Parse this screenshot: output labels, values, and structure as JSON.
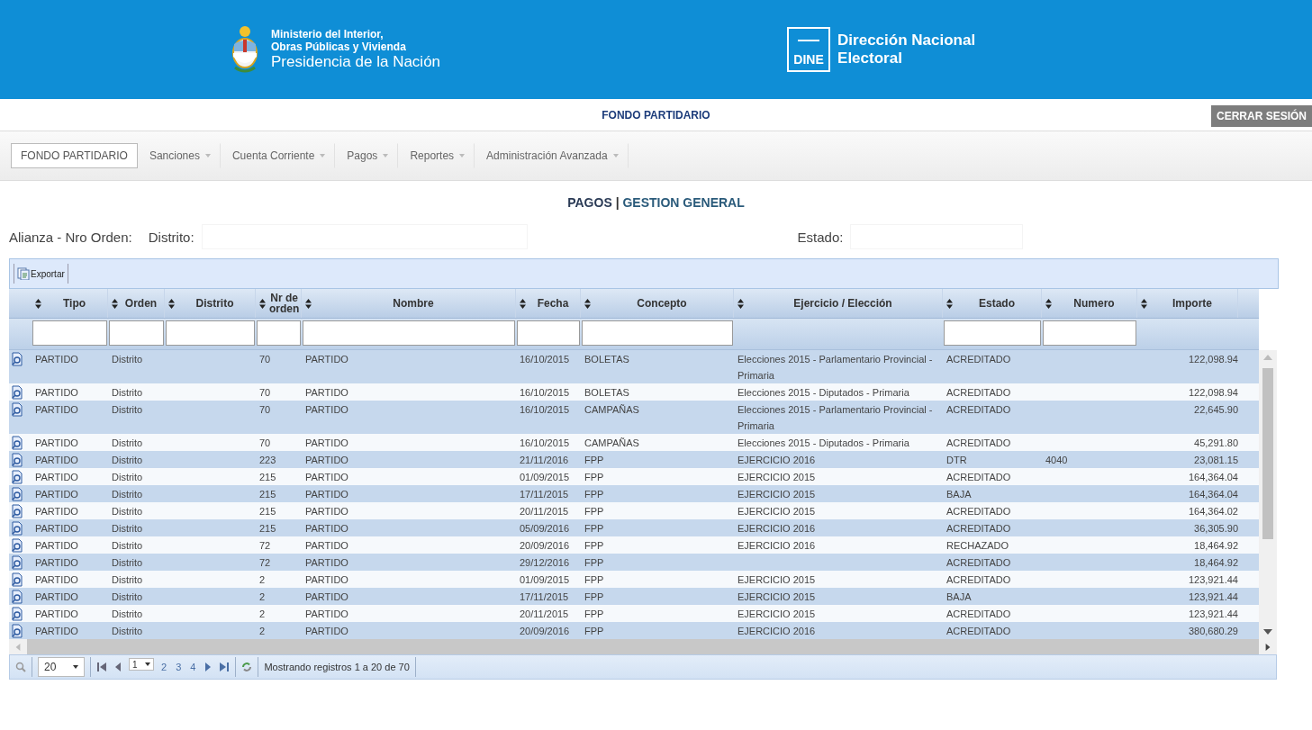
{
  "header": {
    "ministry_lines": [
      "Ministerio del Interior,",
      "Obras Públicas y Vivienda"
    ],
    "presidency": "Presidencia de la Nación",
    "dine_badge": "DINE",
    "dine_title_lines": [
      "Dirección Nacional",
      "Electoral"
    ]
  },
  "top_bar": {
    "title": "FONDO PARTIDARIO",
    "logout": "CERRAR SESIÓN"
  },
  "menu": [
    {
      "label": "FONDO PARTIDARIO",
      "selected": true,
      "dropdown": false
    },
    {
      "label": "Sanciones",
      "selected": false,
      "dropdown": true
    },
    {
      "label": "Cuenta Corriente",
      "selected": false,
      "dropdown": true
    },
    {
      "label": "Pagos",
      "selected": false,
      "dropdown": true
    },
    {
      "label": "Reportes",
      "selected": false,
      "dropdown": true
    },
    {
      "label": "Administración Avanzada",
      "selected": false,
      "dropdown": true
    }
  ],
  "page_title": {
    "section": "PAGOS",
    "separator": "|",
    "subtitle": "GESTION GENERAL"
  },
  "filters": [
    {
      "label": "Alianza - Nro Orden:",
      "kind": "label"
    },
    {
      "label": "Distrito:",
      "kind": "input"
    },
    {
      "label": "Estado:",
      "kind": "input"
    }
  ],
  "toolbar": {
    "export": "Exportar"
  },
  "columns": [
    {
      "label": "Tipo",
      "kind": "filterable"
    },
    {
      "label": "Orden",
      "kind": "filterable"
    },
    {
      "label": "Distrito",
      "kind": "filterable"
    },
    {
      "label": "Nr de orden",
      "kind": "filterable"
    },
    {
      "label": "Nombre",
      "kind": "filterable"
    },
    {
      "label": "Fecha",
      "kind": "filterable"
    },
    {
      "label": "Concepto",
      "kind": "filterable"
    },
    {
      "label": "Ejercicio / Elección",
      "kind": "plain"
    },
    {
      "label": "Estado",
      "kind": "filterable"
    },
    {
      "label": "Numero",
      "kind": "filterable"
    },
    {
      "label": "Importe",
      "kind": "plain"
    }
  ],
  "rows": [
    [
      "PARTIDO",
      "Distrito",
      null,
      "70",
      "PARTIDO",
      "16/10/2015",
      "BOLETAS",
      "Elecciones 2015 - Parlamentario Provincial - Primaria",
      "ACREDITADO",
      null,
      "122,098.94"
    ],
    [
      "PARTIDO",
      "Distrito",
      null,
      "70",
      "PARTIDO",
      "16/10/2015",
      "BOLETAS",
      "Elecciones 2015 - Diputados - Primaria",
      "ACREDITADO",
      null,
      "122,098.94"
    ],
    [
      "PARTIDO",
      "Distrito",
      null,
      "70",
      "PARTIDO",
      "16/10/2015",
      "CAMPAÑAS",
      "Elecciones 2015 - Parlamentario Provincial - Primaria",
      "ACREDITADO",
      null,
      "22,645.90"
    ],
    [
      "PARTIDO",
      "Distrito",
      null,
      "70",
      "PARTIDO",
      "16/10/2015",
      "CAMPAÑAS",
      "Elecciones 2015 - Diputados - Primaria",
      "ACREDITADO",
      null,
      "45,291.80"
    ],
    [
      "PARTIDO",
      "Distrito",
      null,
      "223",
      "PARTIDO",
      "21/11/2016",
      "FPP",
      "EJERCICIO 2016",
      "DTR",
      "4040",
      "23,081.15"
    ],
    [
      "PARTIDO",
      "Distrito",
      null,
      "215",
      "PARTIDO",
      "01/09/2015",
      "FPP",
      "EJERCICIO 2015",
      "ACREDITADO",
      null,
      "164,364.04"
    ],
    [
      "PARTIDO",
      "Distrito",
      null,
      "215",
      "PARTIDO",
      "17/11/2015",
      "FPP",
      "EJERCICIO 2015",
      "BAJA",
      null,
      "164,364.04"
    ],
    [
      "PARTIDO",
      "Distrito",
      null,
      "215",
      "PARTIDO",
      "20/11/2015",
      "FPP",
      "EJERCICIO 2015",
      "ACREDITADO",
      null,
      "164,364.02"
    ],
    [
      "PARTIDO",
      "Distrito",
      null,
      "215",
      "PARTIDO",
      "05/09/2016",
      "FPP",
      "EJERCICIO 2016",
      "ACREDITADO",
      null,
      "36,305.90"
    ],
    [
      "PARTIDO",
      "Distrito",
      null,
      "72",
      "PARTIDO",
      "20/09/2016",
      "FPP",
      "EJERCICIO 2016",
      "RECHAZADO",
      null,
      "18,464.92"
    ],
    [
      "PARTIDO",
      "Distrito",
      null,
      "72",
      "PARTIDO",
      "29/12/2016",
      "FPP",
      null,
      "ACREDITADO",
      null,
      "18,464.92"
    ],
    [
      "PARTIDO",
      "Distrito",
      null,
      "2",
      "PARTIDO",
      "01/09/2015",
      "FPP",
      "EJERCICIO 2015",
      "ACREDITADO",
      null,
      "123,921.44"
    ],
    [
      "PARTIDO",
      "Distrito",
      null,
      "2",
      "PARTIDO",
      "17/11/2015",
      "FPP",
      "EJERCICIO 2015",
      "BAJA",
      null,
      "123,921.44"
    ],
    [
      "PARTIDO",
      "Distrito",
      null,
      "2",
      "PARTIDO",
      "20/11/2015",
      "FPP",
      "EJERCICIO 2015",
      "ACREDITADO",
      null,
      "123,921.44"
    ],
    [
      "PARTIDO",
      "Distrito",
      null,
      "2",
      "PARTIDO",
      "20/09/2016",
      "FPP",
      "EJERCICIO 2016",
      "ACREDITADO",
      null,
      "380,680.29"
    ]
  ],
  "pager": {
    "page_size": "20",
    "current_page": "1",
    "pages": [
      "2",
      "3",
      "4"
    ],
    "status": "Mostrando registros 1 a 20 de 70"
  }
}
